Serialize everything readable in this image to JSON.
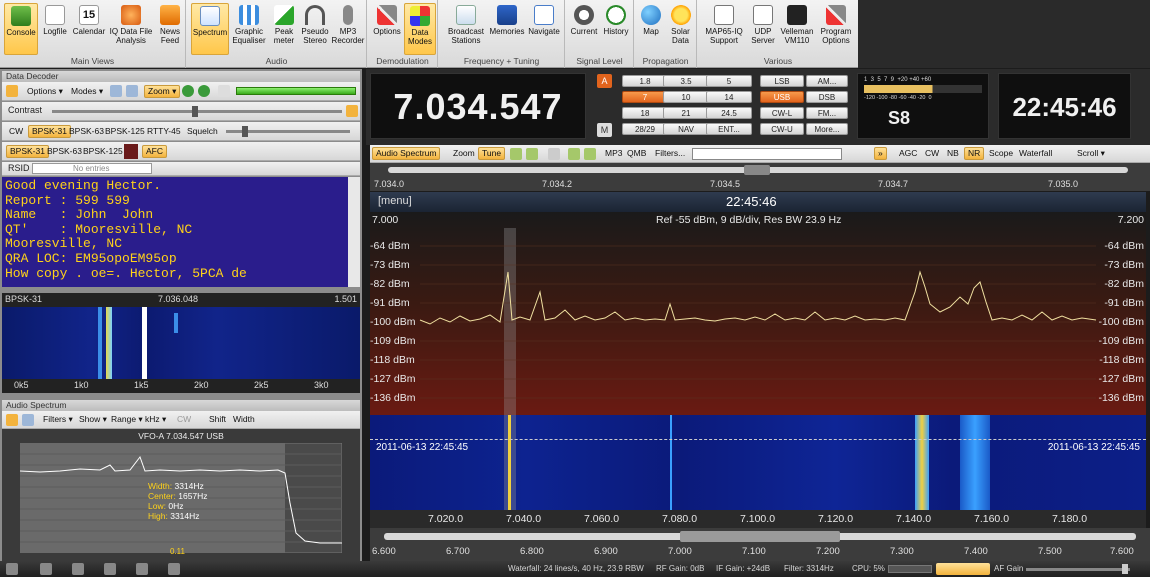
{
  "ribbon": {
    "groups": [
      {
        "title": "Main Views",
        "buttons": [
          "Console",
          "Logfile",
          "Calendar",
          "IQ Data File Analysis",
          "News Feed"
        ]
      },
      {
        "title": "Audio",
        "buttons": [
          "Spectrum",
          "Graphic Equaliser",
          "Peak meter",
          "Pseudo Stereo",
          "MP3 Recorder"
        ]
      },
      {
        "title": "Demodulation",
        "buttons": [
          "Options",
          "Data Modes"
        ]
      },
      {
        "title": "Frequency + Tuning",
        "buttons": [
          "Broadcast Stations",
          "Memories",
          "Navigate"
        ]
      },
      {
        "title": "Signal Level",
        "buttons": [
          "Current",
          "History"
        ]
      },
      {
        "title": "Propagation",
        "buttons": [
          "Map",
          "Solar Data"
        ]
      },
      {
        "title": "Various",
        "buttons": [
          "MAP65-IQ Support",
          "UDP Server",
          "Velleman VM110",
          "Program Options"
        ]
      }
    ],
    "calendar_day": "15"
  },
  "decoder": {
    "title": "Data Decoder",
    "options": "Options",
    "modes": "Modes",
    "zoom": "Zoom",
    "contrast": "Contrast",
    "tabs1": [
      "CW",
      "BPSK-31",
      "BPSK-63",
      "BPSK-125",
      "RTTY-45"
    ],
    "squelch": "Squelch",
    "tabs2": [
      "BPSK-31",
      "BPSK-63",
      "BPSK-125"
    ],
    "afc": "AFC",
    "rsid": "RSID",
    "no_entries": "No entries",
    "text": "Good evening Hector.\nReport : 599 599\nName   : John  John\nQT'    : Mooresville, NC\nMooresville, NC\nQRA LOC: EM95opoEM95op\nHow copy . oe=. Hector, 5PCA de",
    "wf_mode": "BPSK-31",
    "wf_freq": "7.036.048",
    "wf_right": "1.501",
    "wf_scale": [
      "0k5",
      "1k0",
      "1k5",
      "2k0",
      "2k5",
      "3k0"
    ]
  },
  "audio": {
    "title": "Audio Spectrum",
    "filters": "Filters",
    "show": "Show",
    "range": "Range",
    "khz": "kHz",
    "cw": "CW",
    "shift": "Shift",
    "width": "Width",
    "vfo": "VFO-A  7.034.547  USB",
    "width_l": "Width:",
    "width_v": "3314Hz",
    "center_l": "Center:",
    "center_v": "1657Hz",
    "low_l": "Low:",
    "low_v": "0Hz",
    "high_l": "High:",
    "high_v": "3314Hz",
    "level": "0.11"
  },
  "radio": {
    "freq": "7.034.547",
    "a": "A",
    "m": "M",
    "bands": [
      [
        "1.8",
        "3.5",
        "5"
      ],
      [
        "7",
        "10",
        "14"
      ],
      [
        "18",
        "21",
        "24.5"
      ],
      [
        "28/29",
        "NAV",
        "ENT..."
      ]
    ],
    "modes_l": [
      "LSB",
      "USB",
      "CW-L",
      "CW-U"
    ],
    "modes_r": [
      "AM...",
      "DSB",
      "FM...",
      "More..."
    ],
    "smeter": "S8",
    "meter_scale": "1  3  5  7  9  +20 +40 +60",
    "meter_scale2": "-120 -100 -80 -60 -40 -20  0",
    "clock": "22:45:46"
  },
  "spectrum": {
    "toolbar": [
      "Audio Spectrum",
      "Zoom",
      "Tune",
      "MP3",
      "QMB",
      "Filters...",
      "AGC",
      "CW",
      "NB",
      "NR",
      "Scope",
      "Waterfall",
      "Scroll"
    ],
    "top_scale": [
      "7.034.0",
      "7.034.2",
      "7.034.5",
      "7.034.7",
      "7.035.0"
    ],
    "menu": "[menu]",
    "time": "22:45:46",
    "left_freq": "7.000",
    "right_freq": "7.200",
    "ref": "Ref -55 dBm,  9 dB/div,  Res BW 23.9 Hz",
    "db_labels": [
      "-64 dBm",
      "-73 dBm",
      "-82 dBm",
      "-91 dBm",
      "-100 dBm",
      "-109 dBm",
      "-118 dBm",
      "-127 dBm",
      "-136 dBm"
    ],
    "wf_date_l": "2011-06-13  22:45:45",
    "wf_date_r": "2011-06-13  22:45:45",
    "freq_scale": [
      "7.020.0",
      "7.040.0",
      "7.060.0",
      "7.080.0",
      "7.100.0",
      "7.120.0",
      "7.140.0",
      "7.160.0",
      "7.180.0"
    ],
    "band_scale": [
      "6.600",
      "6.700",
      "6.800",
      "6.900",
      "7.000",
      "7.100",
      "7.200",
      "7.300",
      "7.400",
      "7.500",
      "7.600"
    ]
  },
  "status": {
    "waterfall": "Waterfall: 24 lines/s, 40 Hz, 23.9 RBW",
    "rf": "RF Gain: 0dB",
    "if": "IF Gain: +24dB",
    "filter": "Filter: 3314Hz",
    "cpu": "CPU: 5%",
    "af": "AF Gain"
  }
}
